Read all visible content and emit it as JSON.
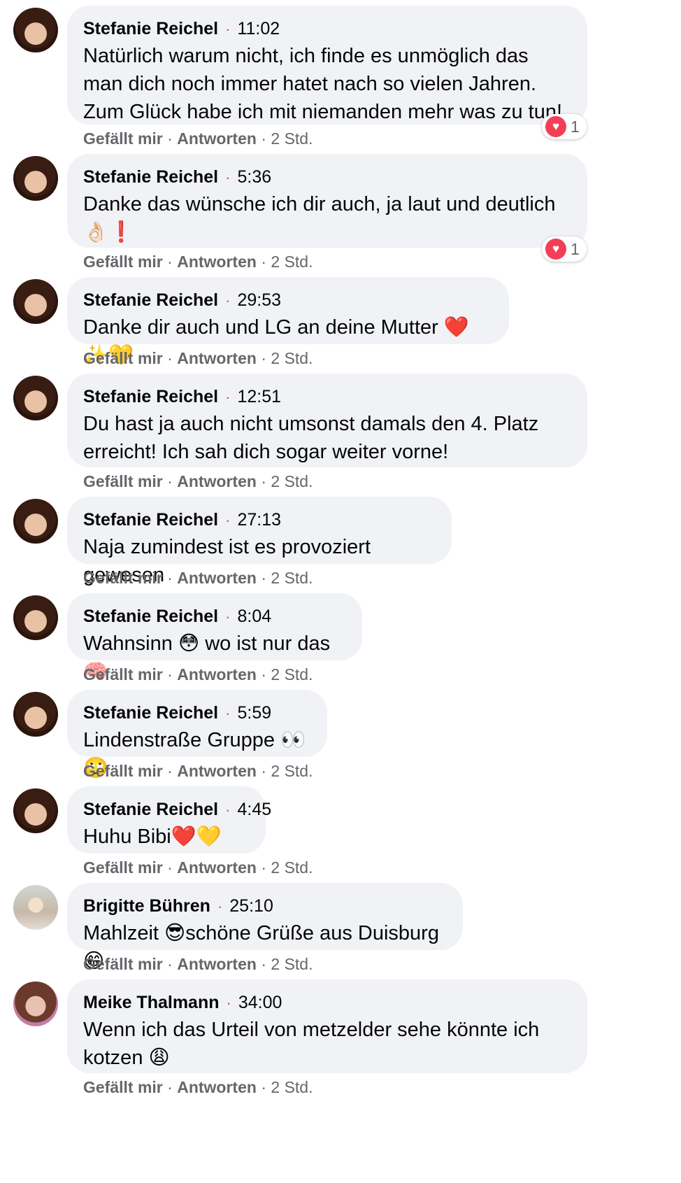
{
  "comments": [
    {
      "name": "Stefanie Reichel",
      "time": "11:02",
      "text": "Natürlich warum nicht, ich finde es unmöglich das man dich noch immer hatet nach so vielen Jahren. Zum Glück habe ich mit niemanden mehr was zu tun!",
      "reaction_count": "1"
    },
    {
      "name": "Stefanie Reichel",
      "time": "5:36",
      "text": "Danke das wünsche ich dir auch, ja laut und deutlich 👌🏻❗",
      "reaction_count": "1"
    },
    {
      "name": "Stefanie Reichel",
      "time": "29:53",
      "text": "Danke dir auch und LG an deine Mutter ❤️✨💛"
    },
    {
      "name": "Stefanie Reichel",
      "time": "12:51",
      "text": "Du hast ja auch nicht umsonst damals den 4. Platz erreicht! Ich sah dich sogar weiter vorne!"
    },
    {
      "name": "Stefanie Reichel",
      "time": "27:13",
      "text": "Naja zumindest ist es provoziert gewesen"
    },
    {
      "name": "Stefanie Reichel",
      "time": "8:04",
      "text": "Wahnsinn 😳 wo ist nur das 🧠"
    },
    {
      "name": "Stefanie Reichel",
      "time": "5:59",
      "text": "Lindenstraße Gruppe 👀🙄"
    },
    {
      "name": "Stefanie Reichel",
      "time": "4:45",
      "text": "Huhu Bibi❤️💛"
    },
    {
      "name": "Brigitte Bühren",
      "time": "25:10",
      "text": "Mahlzeit 😎schöne Grüße aus Duisburg 😁"
    },
    {
      "name": "Meike Thalmann",
      "time": "34:00",
      "text": "Wenn ich das Urteil von metzelder sehe könnte ich kotzen 😩"
    }
  ],
  "actions": {
    "like": "Gefällt mir",
    "reply": "Antworten",
    "age": "2 Std.",
    "dot": "·"
  },
  "colors": {
    "bubble": "#f0f2f5",
    "meta": "#65676b",
    "heart": "#f33e58",
    "time_dot": "#e4414f"
  }
}
